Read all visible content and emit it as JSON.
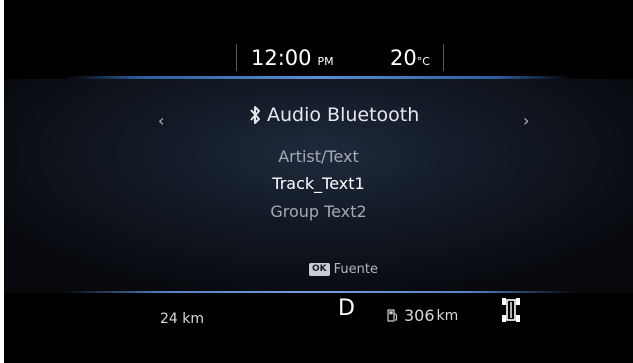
{
  "header": {
    "time": "12:00",
    "ampm": "PM",
    "temperature": "20",
    "temperature_unit": "°C"
  },
  "source": {
    "icon": "bluetooth-icon",
    "title": "Audio Bluetooth",
    "prev_symbol": "‹",
    "next_symbol": "›"
  },
  "track": {
    "artist": "Artist/Text",
    "title": "Track_Text1",
    "group": "Group Text2"
  },
  "footer_hint": {
    "badge": "OK",
    "label": "Fuente"
  },
  "status": {
    "trip_range": "24 km",
    "gear": "D",
    "fuel_range": "306",
    "fuel_unit": "km",
    "icons": [
      "fuel-pump-icon",
      "vehicle-4wd-icon"
    ]
  },
  "colors": {
    "accent_line": "#5a8fd0",
    "text_primary": "#ffffff",
    "text_dim": "#a6aab2"
  }
}
